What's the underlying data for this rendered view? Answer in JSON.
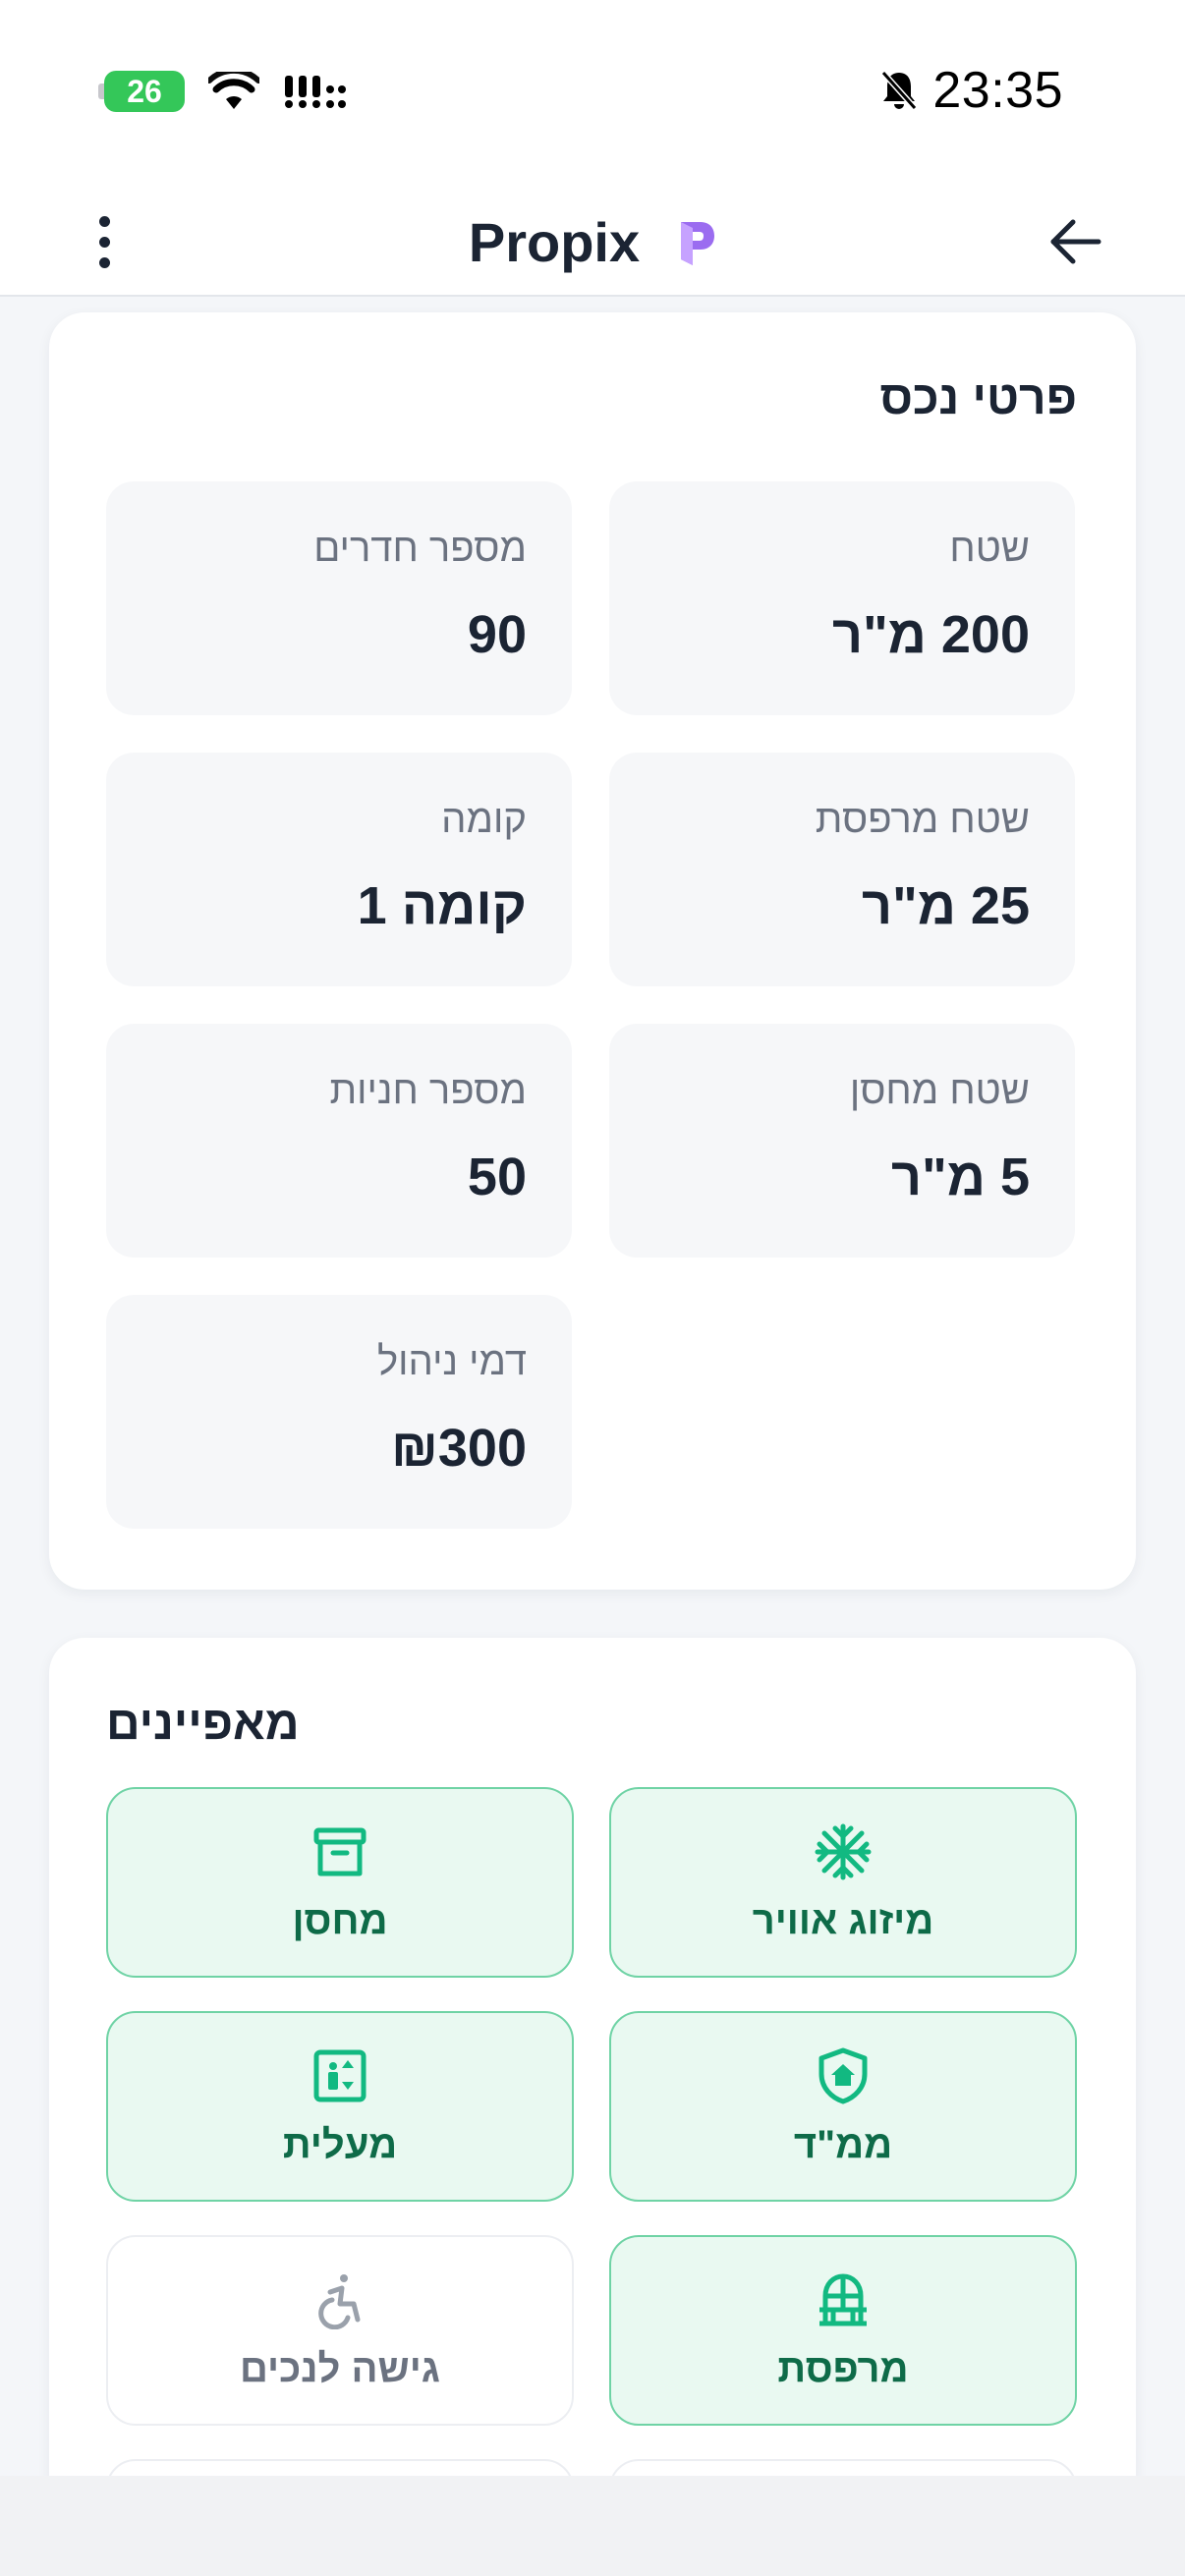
{
  "status_bar": {
    "battery": "26",
    "time": "23:35"
  },
  "app_bar": {
    "title": "Propix"
  },
  "property_details": {
    "title": "פרטי נכס",
    "items": [
      {
        "label": "שטח",
        "value": "200 מ\"ר"
      },
      {
        "label": "מספר חדרים",
        "value": "90"
      },
      {
        "label": "שטח מרפסת",
        "value": "25 מ\"ר"
      },
      {
        "label": "קומה",
        "value": "קומה 1"
      },
      {
        "label": "שטח מחסן",
        "value": "5 מ\"ר"
      },
      {
        "label": "מספר חניות",
        "value": "50"
      },
      {
        "label": "דמי ניהול",
        "value": "₪300"
      }
    ]
  },
  "features": {
    "title": "מאפיינים",
    "items": [
      {
        "label": "מיזוג אוויר",
        "icon": "snowflake-icon",
        "active": true
      },
      {
        "label": "מחסן",
        "icon": "storage-box-icon",
        "active": true
      },
      {
        "label": "ממ\"ד",
        "icon": "shield-home-icon",
        "active": true
      },
      {
        "label": "מעלית",
        "icon": "elevator-icon",
        "active": true
      },
      {
        "label": "מרפסת",
        "icon": "balcony-door-icon",
        "active": true
      },
      {
        "label": "גישה לנכים",
        "icon": "accessible-icon",
        "active": false
      }
    ]
  },
  "colors": {
    "active_bg": "#e9f9f1",
    "active_border": "#6fd3a5",
    "active_text": "#0e6b48",
    "icon_green": "#12b981",
    "logo_purple": "#8b5cf6"
  }
}
